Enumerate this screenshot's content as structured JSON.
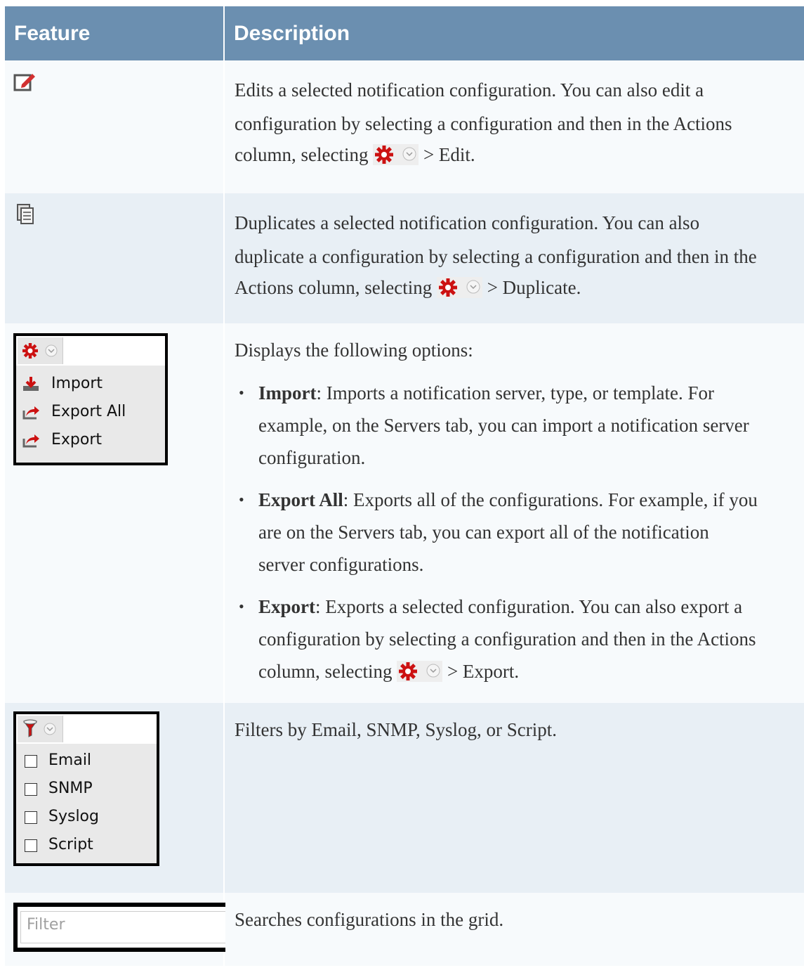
{
  "table": {
    "header": {
      "feature": "Feature",
      "description": "Description"
    },
    "rows": {
      "edit": {
        "icon": "edit-icon",
        "text1": "Edits a selected notification configuration. You can also edit a",
        "text2": "configuration by selecting a configuration and then in the Actions",
        "text3a": "column, selecting",
        "text3b": "> Edit."
      },
      "duplicate": {
        "icon": "duplicate-icon",
        "text1": "Duplicates a selected notification configuration. You can also",
        "text2": "duplicate a configuration by selecting a configuration and then in the",
        "text3a": "Actions column, selecting",
        "text3b": "> Duplicate."
      },
      "actions": {
        "menu": {
          "icon": "gear-icon",
          "items": [
            "Import",
            "Export All",
            "Export"
          ]
        },
        "intro": "Displays the following options:",
        "bullets": [
          {
            "term": "Import",
            "lines": [
              ": Imports a notification server, type, or template. For",
              "example, on the Servers tab, you can import a notification server",
              "configuration."
            ]
          },
          {
            "term": "Export All",
            "lines": [
              ": Exports all of the configurations. For example, if you",
              "are on the Servers tab, you can export all of the notification",
              "server configurations."
            ]
          },
          {
            "term": "Export",
            "lines": [
              ": Exports a selected configuration. You can also export a",
              "configuration by selecting a configuration and then in the Actions",
              "column, selecting",
              "> Export."
            ]
          }
        ]
      },
      "filter": {
        "menu": {
          "icon": "filter-icon",
          "items": [
            "Email",
            "SNMP",
            "Syslog",
            "Script"
          ]
        },
        "text": "Filters by Email, SNMP, Syslog, or Script."
      },
      "search": {
        "placeholder": "Filter",
        "text": "Searches configurations in the grid."
      }
    }
  },
  "colors": {
    "header_bg": "#6b8fb0",
    "alt_row": "#e8eff5",
    "plain_row": "#f7fafc",
    "gear_red": "#cc1111"
  }
}
